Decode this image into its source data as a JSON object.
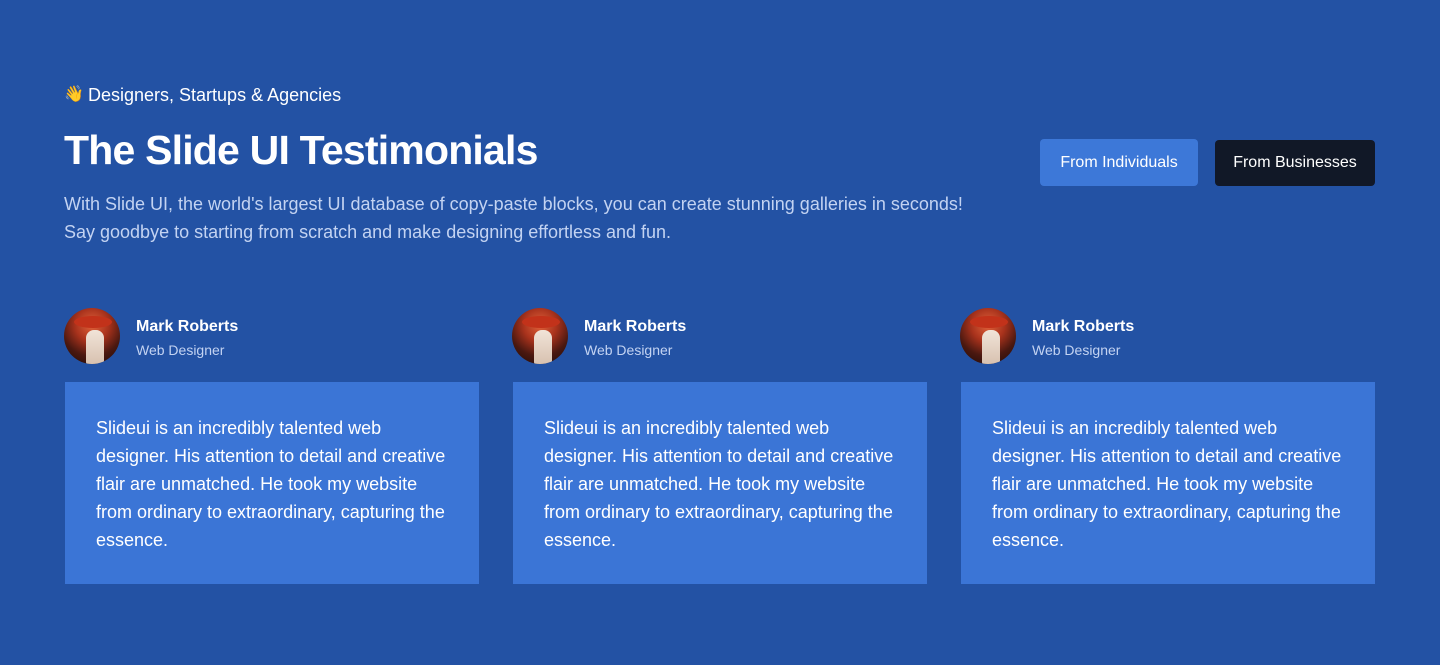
{
  "header": {
    "eyebrow": "Designers, Startups & Agencies",
    "eyebrow_icon": "👋",
    "title": "The Slide UI Testimonials",
    "description": "With Slide UI, the world's largest UI database of copy-paste blocks, you can create stunning galleries in seconds! Say goodbye to starting from scratch and make designing effortless and fun."
  },
  "filters": {
    "individuals_label": "From Individuals",
    "businesses_label": "From Businesses"
  },
  "testimonials": [
    {
      "name": "Mark Roberts",
      "role": "Web Designer",
      "quote": "Slideui is an incredibly talented web designer. His attention to detail and creative flair are unmatched. He took my website from ordinary to extraordinary, capturing the essence."
    },
    {
      "name": "Mark Roberts",
      "role": "Web Designer",
      "quote": "Slideui is an incredibly talented web designer. His attention to detail and creative flair are unmatched. He took my website from ordinary to extraordinary, capturing the essence."
    },
    {
      "name": "Mark Roberts",
      "role": "Web Designer",
      "quote": "Slideui is an incredibly talented web designer. His attention to detail and creative flair are unmatched. He took my website from ordinary to extraordinary, capturing the essence."
    }
  ],
  "colors": {
    "background": "#2352a4",
    "card": "#3b75d6",
    "button_primary": "#3d78d8",
    "button_dark": "#111827",
    "muted_text": "#c3d3f2"
  },
  "icons": {
    "eyebrow": "waving-hand-icon",
    "avatar": "avatar"
  }
}
